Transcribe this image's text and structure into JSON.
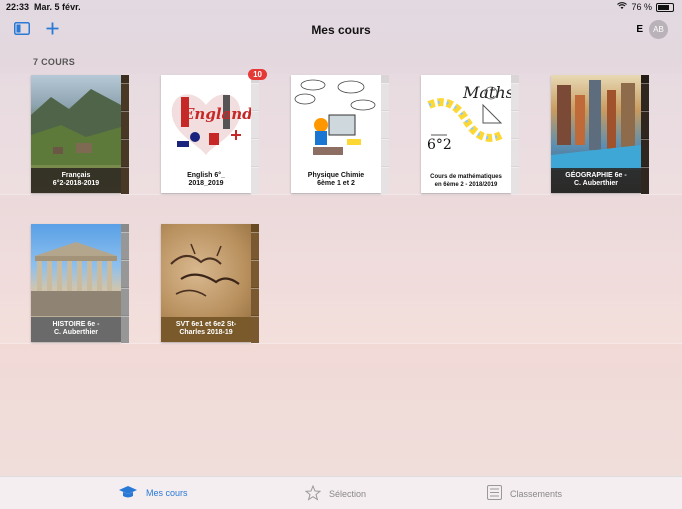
{
  "status": {
    "time": "22:33",
    "date": "Mar. 5 févr.",
    "battery": "76 %"
  },
  "nav": {
    "title": "Mes cours",
    "user_initial": "E",
    "avatar_initials": "AB"
  },
  "section": {
    "count_label": "7 COURS"
  },
  "books": [
    {
      "label": "Français\n6°2-2018-2019",
      "badge": ""
    },
    {
      "label": "English 6°_\n2018_2019",
      "badge": "10",
      "cover_text": "England"
    },
    {
      "label": "Physique Chimie\n6ème 1 et 2",
      "badge": ""
    },
    {
      "label": "Cours de mathématiques\nen 6ème 2 - 2018/2019",
      "badge": "",
      "cover_title": "Maths",
      "cover_sub": "6°2"
    },
    {
      "label": "GÉOGRAPHIE 6e -\nC. Auberthier",
      "badge": ""
    },
    {
      "label": "HISTOIRE 6e -\nC. Auberthier",
      "badge": ""
    },
    {
      "label": "SVT 6e1 et 6e2 St-\nCharles 2018-19",
      "badge": ""
    }
  ],
  "tabs": [
    {
      "label": "Mes cours",
      "icon": "graduation-cap-icon",
      "active": true
    },
    {
      "label": "Sélection",
      "icon": "star-icon",
      "active": false
    },
    {
      "label": "Classements",
      "icon": "list-icon",
      "active": false
    }
  ],
  "colors": {
    "accent": "#2979d6",
    "badge": "#e53935"
  }
}
